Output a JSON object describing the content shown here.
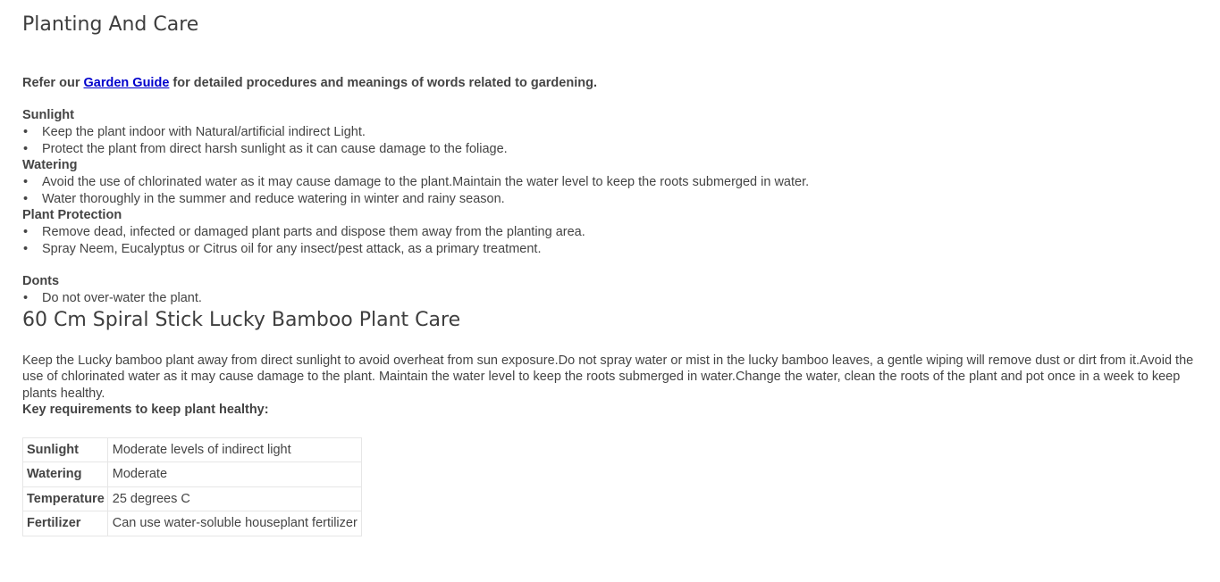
{
  "planting": {
    "title": "Planting And Care",
    "intro_before": "Refer our ",
    "intro_link": "Garden Guide",
    "intro_after": " for detailed procedures and meanings of words related to gardening.",
    "sections": [
      {
        "heading": "Sunlight",
        "items": [
          "Keep the plant indoor with Natural/artificial indirect Light.",
          "Protect the plant from direct harsh sunlight as it can cause damage to the foliage."
        ]
      },
      {
        "heading": "Watering",
        "items": [
          "Avoid the use of chlorinated water as it may cause damage to the plant.Maintain the water level to keep the roots submerged in water.",
          "Water thoroughly in the summer and reduce watering in winter and rainy season."
        ]
      },
      {
        "heading": "Plant Protection",
        "items": [
          "Remove dead, infected or damaged plant parts and dispose them away from the planting area.",
          "Spray Neem, Eucalyptus or Citrus oil for any insect/pest attack, as a primary treatment."
        ]
      },
      {
        "heading": "Donts",
        "items": [
          "Do not over-water the plant."
        ]
      }
    ]
  },
  "care": {
    "title": "60 Cm Spiral Stick Lucky Bamboo Plant Care",
    "text": "Keep the Lucky bamboo plant away from direct sunlight to avoid overheat from sun exposure.Do not spray water or mist in the lucky bamboo leaves, a gentle wiping will remove dust or dirt from it.Avoid the use of chlorinated water as it may cause damage to the plant. Maintain the water level to keep the roots submerged in water.Change the water, clean the roots of the plant and pot once in a week to keep plants healthy.",
    "key_requirements_label": "Key requirements to keep plant healthy:",
    "table": [
      {
        "key": "Sunlight",
        "value": "Moderate levels of indirect light"
      },
      {
        "key": "Watering",
        "value": "Moderate"
      },
      {
        "key": "Temperature",
        "value": "25 degrees C"
      },
      {
        "key": "Fertilizer",
        "value": "Can use water-soluble houseplant fertilizer"
      }
    ]
  }
}
